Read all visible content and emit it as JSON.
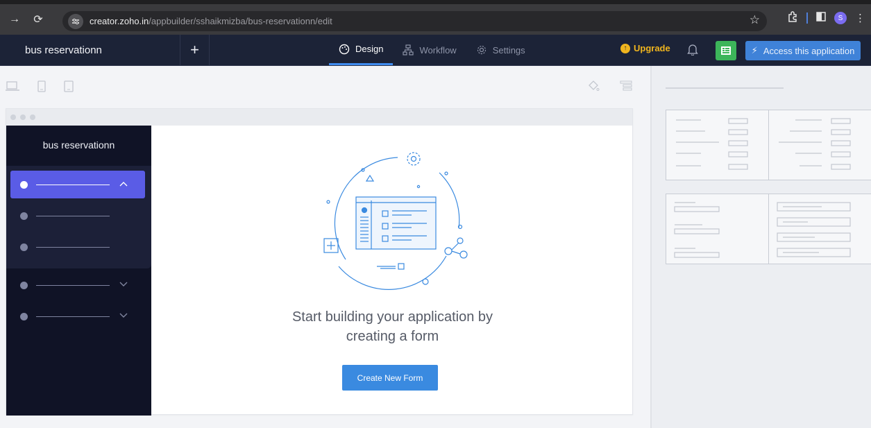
{
  "browser": {
    "url_host": "creator.zoho.in",
    "url_path": "/appbuilder/sshaikmizba/bus-reservationn/edit",
    "profile_initial": "S"
  },
  "header": {
    "app_name": "bus reservationn",
    "tabs": [
      {
        "label": "Design",
        "icon": "palette-icon",
        "active": true
      },
      {
        "label": "Workflow",
        "icon": "workflow-icon",
        "active": false
      },
      {
        "label": "Settings",
        "icon": "gear-icon",
        "active": false
      }
    ],
    "upgrade_label": "Upgrade",
    "access_label": "Access this application"
  },
  "preview": {
    "app_title": "bus reservationn",
    "headline_line1": "Start building your application by",
    "headline_line2": "creating a form",
    "create_button": "Create New Form"
  },
  "colors": {
    "header_bg": "#1c2337",
    "accent_blue": "#3a8ae0",
    "nav_active": "#5a5ce6",
    "upgrade": "#f0b51e",
    "green_button": "#3cb55a"
  }
}
